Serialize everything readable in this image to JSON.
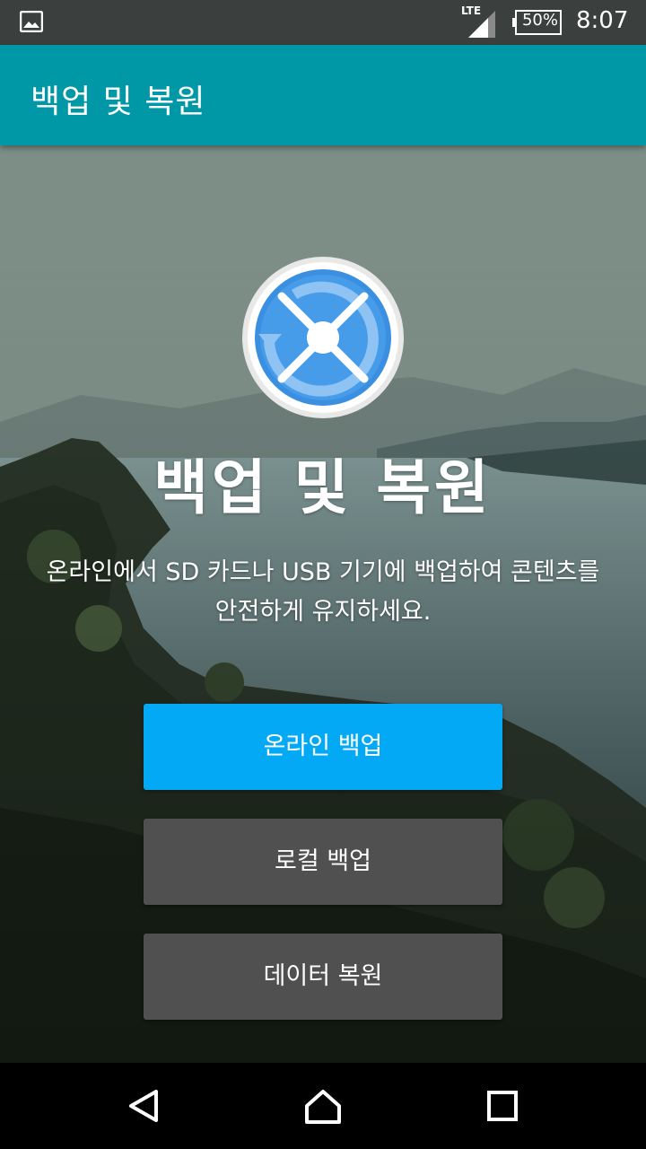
{
  "status_bar": {
    "network": "LTE",
    "battery": "50%",
    "time": "8:07",
    "icons": [
      "gallery-icon",
      "signal-icon",
      "battery-icon"
    ]
  },
  "app_bar": {
    "title": "백업 및 복원"
  },
  "hero": {
    "logo_icon": "backup-restore-logo-icon",
    "title": "백업 및 복원",
    "description_line1": "온라인에서 SD 카드나 USB 기기에 백업하여 콘텐츠를",
    "description_line2": "안전하게 유지하세요."
  },
  "buttons": {
    "online_backup": "온라인 백업",
    "local_backup": "로컬 백업",
    "restore_data": "데이터 복원"
  },
  "nav_bar": {
    "icons": [
      "back-icon",
      "home-icon",
      "recent-apps-icon"
    ]
  },
  "colors": {
    "app_bar": "#0097a7",
    "primary_button": "#03a9f4",
    "secondary_button": "#505050",
    "status_bar": "#3b3f3d",
    "nav_bar": "#000000"
  }
}
